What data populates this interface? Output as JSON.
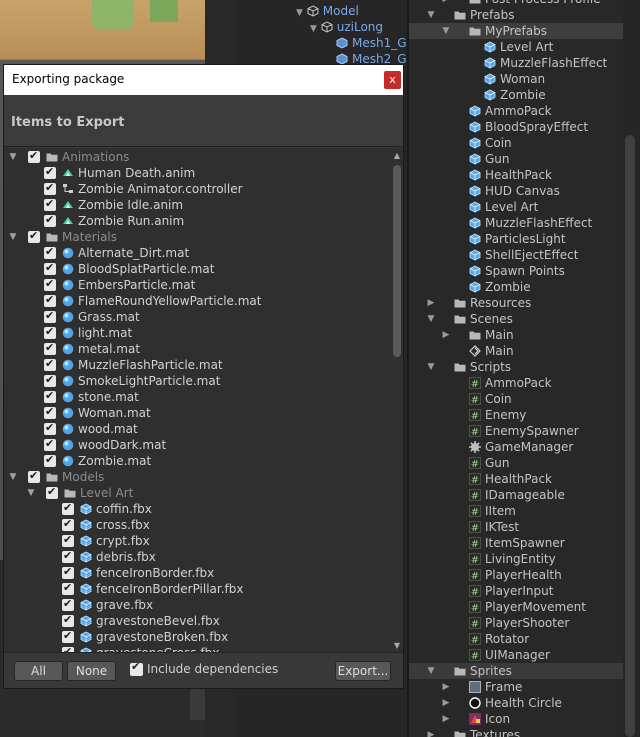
{
  "hierarchy": {
    "rows": [
      "Model",
      "uziLong",
      "Mesh1_G",
      "Mesh2_G"
    ]
  },
  "dialog": {
    "title": "Exporting package",
    "close_label": "x",
    "header": "Items to Export",
    "tree": [
      {
        "label": "Animations",
        "type": "folder",
        "group": true,
        "expanded": true
      },
      {
        "label": "Human Death.anim",
        "type": "anim"
      },
      {
        "label": "Zombie Animator.controller",
        "type": "controller"
      },
      {
        "label": "Zombie Idle.anim",
        "type": "anim"
      },
      {
        "label": "Zombie Run.anim",
        "type": "anim"
      },
      {
        "label": "Materials",
        "type": "folder",
        "group": true,
        "expanded": true
      },
      {
        "label": "Alternate_Dirt.mat",
        "type": "mat"
      },
      {
        "label": "BloodSplatParticle.mat",
        "type": "mat"
      },
      {
        "label": "EmbersParticle.mat",
        "type": "mat"
      },
      {
        "label": "FlameRoundYellowParticle.mat",
        "type": "mat"
      },
      {
        "label": "Grass.mat",
        "type": "mat"
      },
      {
        "label": "light.mat",
        "type": "mat"
      },
      {
        "label": "metal.mat",
        "type": "mat"
      },
      {
        "label": "MuzzleFlashParticle.mat",
        "type": "mat"
      },
      {
        "label": "SmokeLightParticle.mat",
        "type": "mat"
      },
      {
        "label": "stone.mat",
        "type": "mat"
      },
      {
        "label": "Woman.mat",
        "type": "mat"
      },
      {
        "label": "wood.mat",
        "type": "mat"
      },
      {
        "label": "woodDark.mat",
        "type": "mat"
      },
      {
        "label": "Zombie.mat",
        "type": "mat"
      },
      {
        "label": "Models",
        "type": "folder",
        "group": true,
        "expanded": true
      },
      {
        "label": "Level Art",
        "type": "folder",
        "group": true,
        "expanded": true,
        "sub": true
      },
      {
        "label": "coffin.fbx",
        "type": "fbx",
        "sub": true
      },
      {
        "label": "cross.fbx",
        "type": "fbx",
        "sub": true
      },
      {
        "label": "crypt.fbx",
        "type": "fbx",
        "sub": true
      },
      {
        "label": "debris.fbx",
        "type": "fbx",
        "sub": true
      },
      {
        "label": "fenceIronBorder.fbx",
        "type": "fbx",
        "sub": true
      },
      {
        "label": "fenceIronBorderPillar.fbx",
        "type": "fbx",
        "sub": true
      },
      {
        "label": "grave.fbx",
        "type": "fbx",
        "sub": true
      },
      {
        "label": "gravestoneBevel.fbx",
        "type": "fbx",
        "sub": true
      },
      {
        "label": "gravestoneBroken.fbx",
        "type": "fbx",
        "sub": true
      },
      {
        "label": "gravestoneCross.fbx",
        "type": "fbx",
        "sub": true
      }
    ],
    "buttons": {
      "all": "All",
      "none": "None",
      "export": "Export..."
    },
    "include_dependencies": "Include dependencies"
  },
  "project": {
    "rows": [
      {
        "label": "Post Process Profile",
        "indent": 1,
        "type": "folder"
      },
      {
        "label": "Prefabs",
        "indent": 0,
        "type": "folder",
        "expanded": true
      },
      {
        "label": "MyPrefabs",
        "indent": 1,
        "type": "folder",
        "expanded": true,
        "selected": true
      },
      {
        "label": "Level Art",
        "indent": 2,
        "type": "prefab"
      },
      {
        "label": "MuzzleFlashEffect",
        "indent": 2,
        "type": "prefab"
      },
      {
        "label": "Woman",
        "indent": 2,
        "type": "prefab"
      },
      {
        "label": "Zombie",
        "indent": 2,
        "type": "prefab"
      },
      {
        "label": "AmmoPack",
        "indent": 1,
        "type": "prefab"
      },
      {
        "label": "BloodSprayEffect",
        "indent": 1,
        "type": "prefab"
      },
      {
        "label": "Coin",
        "indent": 1,
        "type": "prefab"
      },
      {
        "label": "Gun",
        "indent": 1,
        "type": "prefab"
      },
      {
        "label": "HealthPack",
        "indent": 1,
        "type": "prefab"
      },
      {
        "label": "HUD Canvas",
        "indent": 1,
        "type": "prefab"
      },
      {
        "label": "Level Art",
        "indent": 1,
        "type": "prefab"
      },
      {
        "label": "MuzzleFlashEffect",
        "indent": 1,
        "type": "prefab"
      },
      {
        "label": "ParticlesLight",
        "indent": 1,
        "type": "prefab"
      },
      {
        "label": "ShellEjectEffect",
        "indent": 1,
        "type": "prefab"
      },
      {
        "label": "Spawn Points",
        "indent": 1,
        "type": "prefab"
      },
      {
        "label": "Zombie",
        "indent": 1,
        "type": "prefab"
      },
      {
        "label": "Resources",
        "indent": 0,
        "type": "folder"
      },
      {
        "label": "Scenes",
        "indent": 0,
        "type": "folder",
        "expanded": true
      },
      {
        "label": "Main",
        "indent": 1,
        "type": "folder"
      },
      {
        "label": "Main",
        "indent": 1,
        "type": "scene"
      },
      {
        "label": "Scripts",
        "indent": 0,
        "type": "folder",
        "expanded": true
      },
      {
        "label": "AmmoPack",
        "indent": 1,
        "type": "script"
      },
      {
        "label": "Coin",
        "indent": 1,
        "type": "script"
      },
      {
        "label": "Enemy",
        "indent": 1,
        "type": "script"
      },
      {
        "label": "EnemySpawner",
        "indent": 1,
        "type": "script"
      },
      {
        "label": "GameManager",
        "indent": 1,
        "type": "gear"
      },
      {
        "label": "Gun",
        "indent": 1,
        "type": "script"
      },
      {
        "label": "HealthPack",
        "indent": 1,
        "type": "script"
      },
      {
        "label": "IDamageable",
        "indent": 1,
        "type": "script"
      },
      {
        "label": "IItem",
        "indent": 1,
        "type": "script"
      },
      {
        "label": "IKTest",
        "indent": 1,
        "type": "script"
      },
      {
        "label": "ItemSpawner",
        "indent": 1,
        "type": "script"
      },
      {
        "label": "LivingEntity",
        "indent": 1,
        "type": "script"
      },
      {
        "label": "PlayerHealth",
        "indent": 1,
        "type": "script"
      },
      {
        "label": "PlayerInput",
        "indent": 1,
        "type": "script"
      },
      {
        "label": "PlayerMovement",
        "indent": 1,
        "type": "script"
      },
      {
        "label": "PlayerShooter",
        "indent": 1,
        "type": "script"
      },
      {
        "label": "Rotator",
        "indent": 1,
        "type": "script"
      },
      {
        "label": "UIManager",
        "indent": 1,
        "type": "script"
      },
      {
        "label": "Sprites",
        "indent": 0,
        "type": "folder",
        "expanded": true,
        "highlight": true
      },
      {
        "label": "Frame",
        "indent": 1,
        "type": "sprite-frame",
        "collapsible": true
      },
      {
        "label": "Health Circle",
        "indent": 1,
        "type": "sprite-circle",
        "collapsible": true
      },
      {
        "label": "Icon",
        "indent": 1,
        "type": "sprite-icon",
        "collapsible": true
      },
      {
        "label": "Textures",
        "indent": 0,
        "type": "folder"
      }
    ]
  }
}
